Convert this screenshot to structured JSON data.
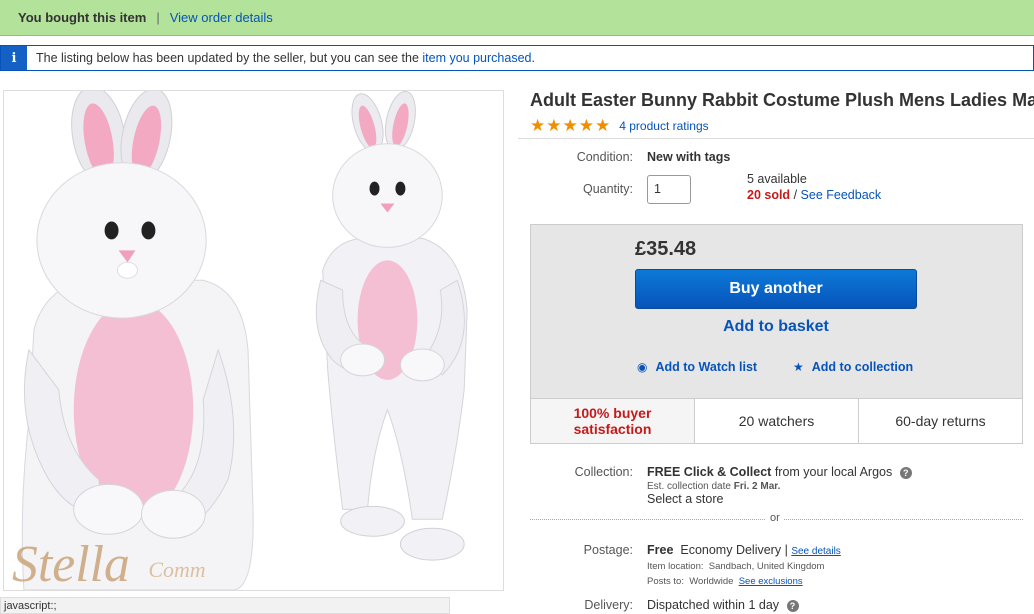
{
  "banner": {
    "bought_text": "You bought this item",
    "separator": "|",
    "view_order_link": "View order details"
  },
  "info_bar": {
    "icon": "i",
    "message": "The listing below has been updated by the seller, but you can see the",
    "link": "item you purchased",
    "end": "."
  },
  "image": {
    "watermark_main": "Stella",
    "watermark_sub": "Comm"
  },
  "status_bar": "javascript:;",
  "listing": {
    "title": "Adult Easter Bunny Rabbit Costume Plush Mens Ladies Ma",
    "stars": 5,
    "ratings_link": "4 product ratings",
    "condition_label": "Condition:",
    "condition_value": "New with tags",
    "quantity_label": "Quantity:",
    "quantity_value": "1",
    "available": "5 available",
    "sold": "20 sold",
    "sold_sep": "/",
    "feedback_link": "See Feedback"
  },
  "buy_box": {
    "price": "£35.48",
    "buy_button": "Buy another",
    "basket_link": "Add to basket",
    "watch_link": "Add to Watch list",
    "collection_link": "Add to collection"
  },
  "stats": {
    "satisfaction_line1": "100% buyer",
    "satisfaction_line2": "satisfaction",
    "watchers": "20 watchers",
    "returns": "60-day returns"
  },
  "collection": {
    "label": "Collection:",
    "free": "FREE Click & Collect",
    "from": "from your local Argos",
    "est_label": "Est. collection date",
    "est_date": "Fri. 2 Mar.",
    "store_link": "Select a store"
  },
  "or_text": "or",
  "postage": {
    "label": "Postage:",
    "free": "Free",
    "method": "Economy Delivery",
    "sep": "|",
    "details_link": "See details",
    "location_label": "Item location:",
    "location": "Sandbach, United Kingdom",
    "posts_label": "Posts to:",
    "posts_to": "Worldwide",
    "exclusions_link": "See exclusions"
  },
  "delivery": {
    "label": "Delivery:",
    "value": "Dispatched within 1 day"
  },
  "colors": {
    "banner_bg": "#b3e29b",
    "link": "#0654ba",
    "star": "#f18e00",
    "sold_red": "#c41a1a",
    "buy_button": "#0654ba"
  }
}
